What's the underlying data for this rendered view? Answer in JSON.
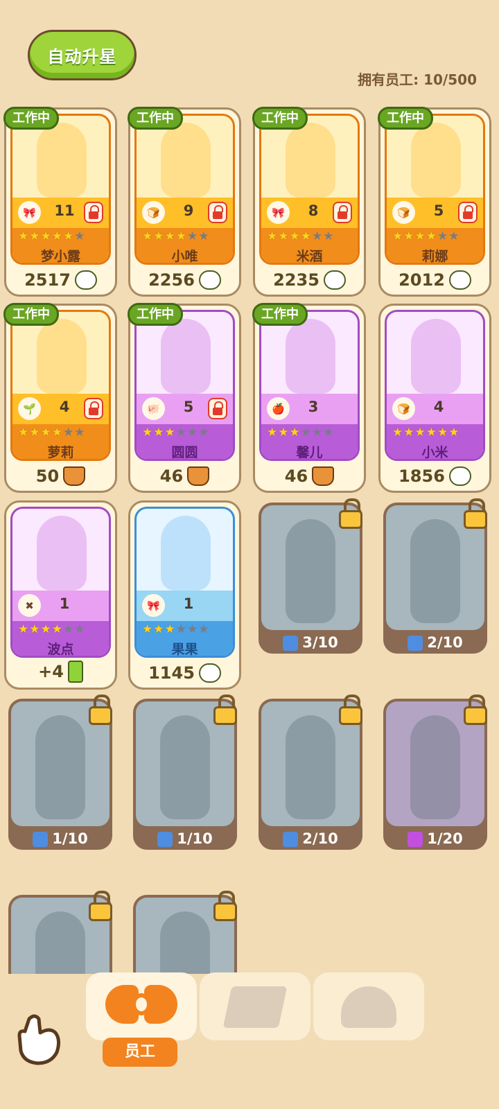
{
  "header": {
    "auto_star_label": "自动升星",
    "staff_count": "拥有员工: 10/500"
  },
  "working_badge": "工作中",
  "employees": [
    {
      "name": "梦小露",
      "level": "11",
      "stars": 5,
      "value": "2517",
      "value_icon": "cloud-icon",
      "theme": "orange",
      "working": true,
      "locked_level": true,
      "stat_icon": "bow-icon"
    },
    {
      "name": "小唯",
      "level": "9",
      "stars": 4,
      "value": "2256",
      "value_icon": "cloud-icon",
      "theme": "orange",
      "working": true,
      "locked_level": true,
      "stat_icon": "chef-hat-icon"
    },
    {
      "name": "米酒",
      "level": "8",
      "stars": 4,
      "value": "2235",
      "value_icon": "cloud-icon",
      "theme": "orange",
      "working": true,
      "locked_level": true,
      "stat_icon": "bow-icon"
    },
    {
      "name": "莉娜",
      "level": "5",
      "stars": 4,
      "value": "2012",
      "value_icon": "cloud-icon",
      "theme": "orange",
      "working": true,
      "locked_level": true,
      "stat_icon": "chef-hat-icon"
    },
    {
      "name": "萝莉",
      "level": "4",
      "stars": 4,
      "value": "50",
      "value_icon": "basket-icon",
      "theme": "orange",
      "working": true,
      "locked_level": true,
      "stat_icon": "sprout-icon"
    },
    {
      "name": "圆圆",
      "level": "5",
      "stars": 3,
      "value": "46",
      "value_icon": "basket-icon",
      "theme": "purple",
      "working": true,
      "locked_level": true,
      "stat_icon": "pig-icon"
    },
    {
      "name": "馨儿",
      "level": "3",
      "stars": 3,
      "value": "46",
      "value_icon": "basket-icon",
      "theme": "purple",
      "working": true,
      "locked_level": false,
      "stat_icon": "apple-icon"
    },
    {
      "name": "小米",
      "level": "4",
      "stars": 6,
      "value": "1856",
      "value_icon": "cloud-icon",
      "theme": "purple",
      "working": false,
      "locked_level": false,
      "stat_icon": "chef-hat-icon"
    },
    {
      "name": "波点",
      "level": "1",
      "stars": 4,
      "value": "+4",
      "value_icon": "battery-icon",
      "theme": "purple",
      "working": false,
      "locked_level": false,
      "stat_icon": "cross-icon"
    },
    {
      "name": "果果",
      "level": "1",
      "stars": 3,
      "value": "1145",
      "value_icon": "cloud-icon",
      "theme": "blue",
      "working": false,
      "locked_level": false,
      "stat_icon": "bow-icon"
    }
  ],
  "locked_employees": [
    {
      "fragments": "3/10",
      "theme": "blue"
    },
    {
      "fragments": "2/10",
      "theme": "blue"
    },
    {
      "fragments": "1/10",
      "theme": "blue"
    },
    {
      "fragments": "1/10",
      "theme": "blue"
    },
    {
      "fragments": "2/10",
      "theme": "blue"
    },
    {
      "fragments": "1/20",
      "theme": "purple"
    },
    {
      "fragments": "",
      "theme": "blue"
    },
    {
      "fragments": "",
      "theme": "blue"
    }
  ],
  "tabs": {
    "staff_label": "员工"
  },
  "colors": {
    "background": "#f1dcb6",
    "accent_orange": "#f2831e",
    "accent_green": "#9fd43a",
    "purple_theme": "#b95cd8",
    "blue_theme": "#4aa1e4"
  }
}
